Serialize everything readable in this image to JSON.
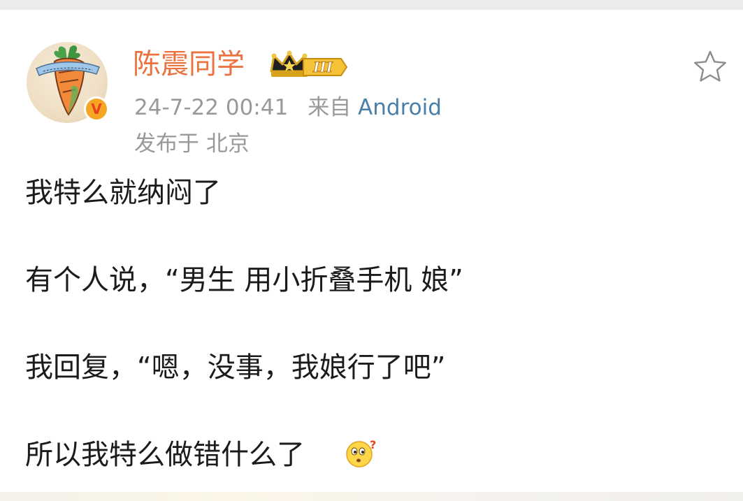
{
  "post": {
    "author": {
      "name": "陈震同学",
      "avatar_icon": "carrot-tattoo-avatar",
      "verified_icon": "verified-v-badge",
      "verified_label": "V",
      "vip_icon": "crown-level-badge",
      "vip_level": "III"
    },
    "meta": {
      "time": "24-7-22 00:41",
      "source_prefix": "来自",
      "source": "Android",
      "location": "发布于 北京"
    },
    "actions": {
      "favorite_icon": "star-outline-icon"
    },
    "content": {
      "lines": [
        "我特么就纳闷了",
        "有个人说，“男生 用小折叠手机 娘”",
        "我回复，“嗯，没事，我娘行了吧”",
        "所以我特么做错什么了"
      ],
      "emoji_icon": "confused-face-emoji"
    }
  },
  "colors": {
    "username": "#eb7340",
    "meta_text": "#999999",
    "device_link": "#4a7fa8",
    "body_text": "#1b1b1b",
    "badge_orange": "#f5a623",
    "badge_red": "#e8431d"
  }
}
